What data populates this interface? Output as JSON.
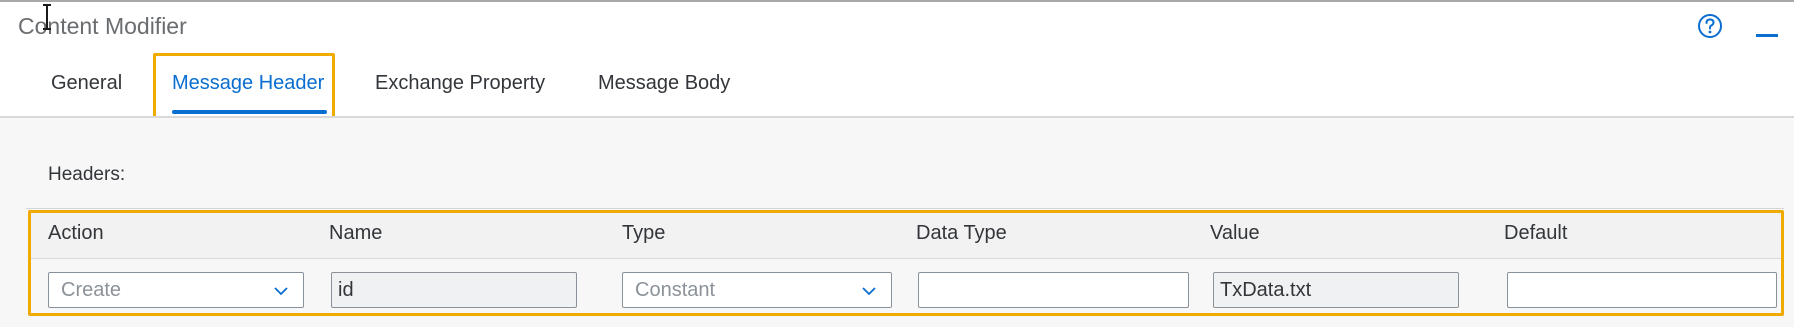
{
  "window": {
    "title": "Content Modifier"
  },
  "tabs": [
    {
      "label": "General",
      "active": false
    },
    {
      "label": "Message Header",
      "active": true
    },
    {
      "label": "Exchange Property",
      "active": false
    },
    {
      "label": "Message Body",
      "active": false
    }
  ],
  "headers_section": {
    "label": "Headers:",
    "columns": [
      "Action",
      "Name",
      "Type",
      "Data Type",
      "Value",
      "Default"
    ],
    "rows": [
      {
        "action": "Create",
        "name": "id",
        "type": "Constant",
        "data_type": "",
        "value": "TxData.txt",
        "default": ""
      }
    ]
  },
  "icons": {
    "help": "help-circle-icon",
    "minimize": "minimize-icon",
    "cursor": "text-cursor-icon",
    "dropdown": "chevron-down-icon"
  },
  "colors": {
    "accent": "#0a6ed1",
    "highlight": "#f0ab00",
    "text": "#32363a",
    "muted": "#6a6d70"
  }
}
